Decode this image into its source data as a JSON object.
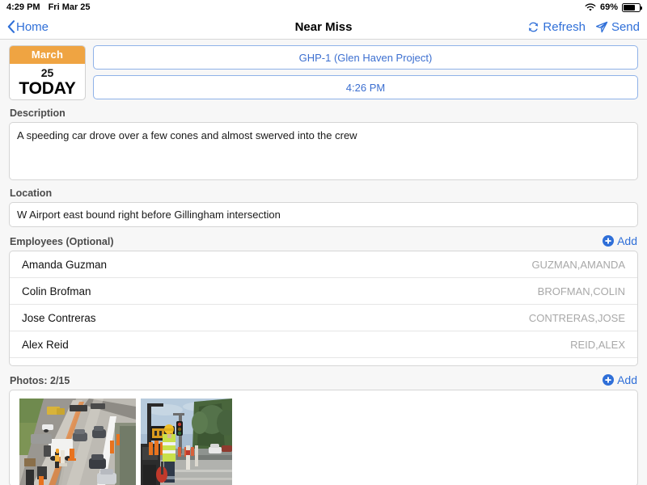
{
  "statusbar": {
    "time": "4:29 PM",
    "date": "Fri Mar 25",
    "battery_percent": "69%",
    "wifi_icon": "wifi-icon",
    "battery_icon": "battery-icon"
  },
  "navbar": {
    "back_label": "Home",
    "back_icon": "chevron-left-icon",
    "title": "Near Miss",
    "refresh_label": "Refresh",
    "refresh_icon": "refresh-icon",
    "send_label": "Send",
    "send_icon": "paper-plane-icon"
  },
  "date_badge": {
    "month": "March",
    "day": "25",
    "today": "TODAY",
    "accent_color": "#efa442"
  },
  "top_fields": {
    "project": "GHP-1 (Glen Haven Project)",
    "time": "4:26 PM",
    "border_color": "#8fb2e8",
    "text_color": "#3c6fd0"
  },
  "description": {
    "label": "Description",
    "value": "A speeding car drove over a few cones and almost swerved into the crew",
    "placeholder": "Description"
  },
  "location": {
    "label": "Location",
    "value": "W Airport east bound right before Gillingham intersection",
    "placeholder": "Location"
  },
  "employees": {
    "label": "Employees (Optional)",
    "add_label": "Add",
    "add_icon": "add-circle-icon",
    "rows": [
      {
        "name": "Amanda Guzman",
        "code": "GUZMAN,AMANDA"
      },
      {
        "name": "Colin Brofman",
        "code": "BROFMAN,COLIN"
      },
      {
        "name": "Jose Contreras",
        "code": "CONTRERAS,JOSE"
      },
      {
        "name": "Alex Reid",
        "code": "REID,ALEX"
      }
    ]
  },
  "photos": {
    "label": "Photos: 2/15",
    "add_label": "Add",
    "add_icon": "add-circle-icon",
    "items": [
      {
        "alt": "highway-construction-traffic-photo"
      },
      {
        "alt": "roadside-worker-hivis-photo"
      }
    ]
  },
  "colors": {
    "accent_blue": "#2f6fd8",
    "page_background": "#f7f7f7",
    "field_background": "#ffffff"
  }
}
